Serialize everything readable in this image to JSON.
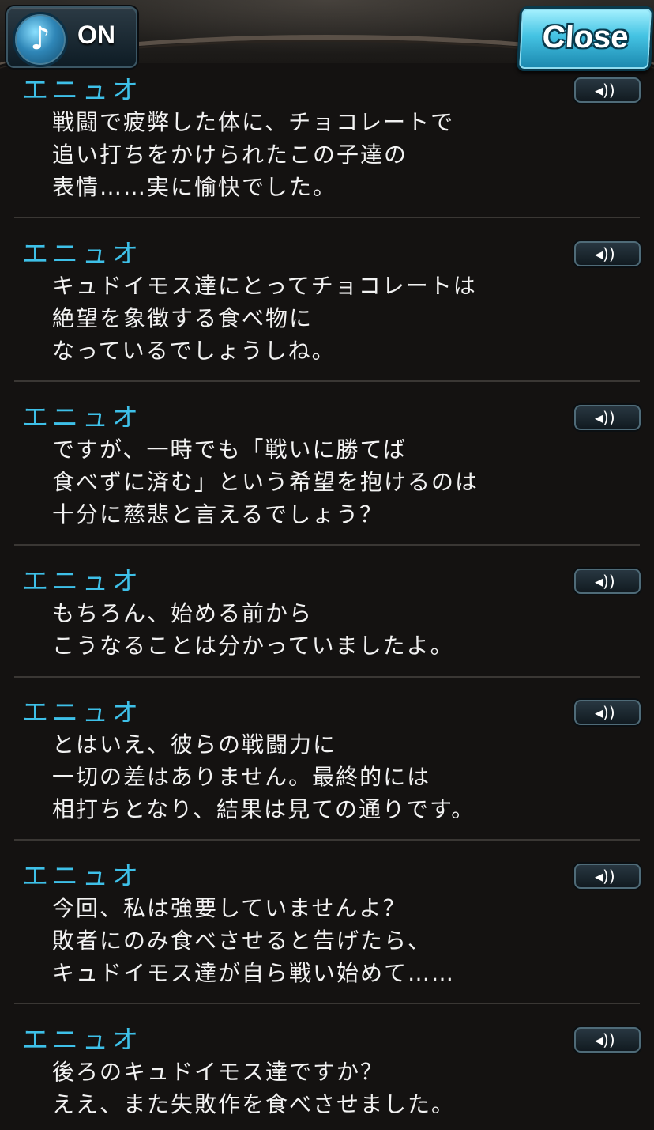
{
  "header": {
    "bgm_label": "ON",
    "bgm_icon": "music-note-icon",
    "close_label": "Close"
  },
  "entries": [
    {
      "speaker": "エニュオ",
      "lines": [
        "戦闘で疲弊した体に、チョコレートで",
        "追い打ちをかけられたこの子達の",
        "表情……実に愉快でした。"
      ]
    },
    {
      "speaker": "エニュオ",
      "lines": [
        "キュドイモス達にとってチョコレートは",
        "絶望を象徴する食べ物に",
        "なっているでしょうしね。"
      ]
    },
    {
      "speaker": "エニュオ",
      "lines": [
        "ですが、一時でも「戦いに勝てば",
        "食べずに済む」という希望を抱けるのは",
        "十分に慈悲と言えるでしょう？"
      ]
    },
    {
      "speaker": "エニュオ",
      "lines": [
        "もちろん、始める前から",
        "こうなることは分かっていましたよ。"
      ]
    },
    {
      "speaker": "エニュオ",
      "lines": [
        "とはいえ、彼らの戦闘力に",
        "一切の差はありません。最終的には",
        "相打ちとなり、結果は見ての通りです。"
      ]
    },
    {
      "speaker": "エニュオ",
      "lines": [
        "今回、私は強要していませんよ？",
        "敗者にのみ食べさせると告げたら、",
        "キュドイモス達が自ら戦い始めて……"
      ]
    },
    {
      "speaker": "エニュオ",
      "lines": [
        "後ろのキュドイモス達ですか？",
        "ええ、また失敗作を食べさせました。"
      ]
    }
  ],
  "colors": {
    "speaker": "#3ec0e8",
    "text": "#f2f2f2",
    "background": "#141211",
    "accent": "#44c3e3"
  }
}
